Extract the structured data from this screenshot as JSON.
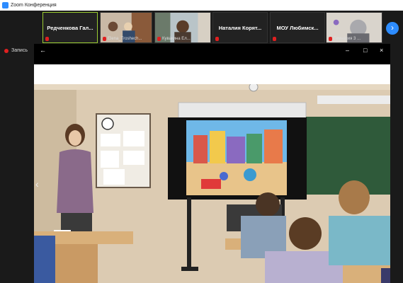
{
  "window": {
    "title": "Zoom Конференция"
  },
  "participants": [
    {
      "display_name": "Редченкова  Гал...",
      "type": "name"
    },
    {
      "caption": "Elena_Troshech...",
      "type": "video"
    },
    {
      "caption": "Кувакина Ел...",
      "type": "video"
    },
    {
      "display_name": "Наталия  Корят...",
      "type": "name"
    },
    {
      "display_name": "МОУ Любимск...",
      "type": "name"
    },
    {
      "caption": "Гимназия 3 ...",
      "type": "video"
    }
  ],
  "recording": {
    "label": "Запись"
  },
  "viewer": {
    "controls": {
      "back": "←",
      "minimize": "–",
      "maximize": "□",
      "close": "×"
    },
    "nav_prev": "‹"
  },
  "strip_next": "›",
  "colors": {
    "accent": "#2d8cff",
    "record": "#e02020",
    "active_border": "#9acd32"
  }
}
